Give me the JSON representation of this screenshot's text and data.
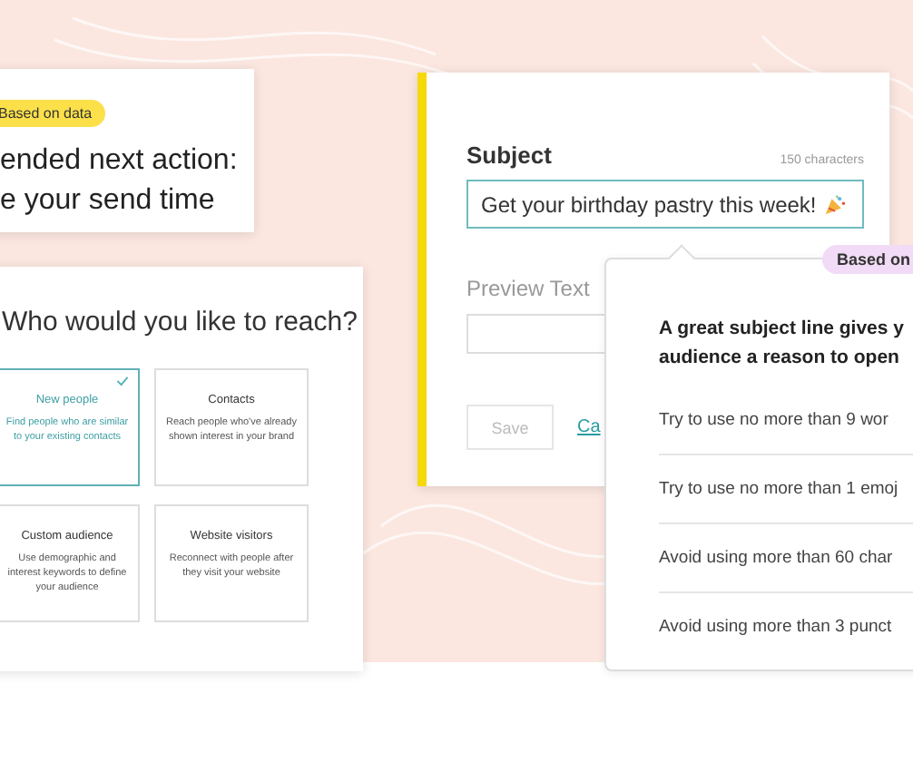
{
  "recommendation_card": {
    "badge": "Based on data",
    "lines": [
      "ended next action:",
      "e your send time"
    ]
  },
  "audience_card": {
    "title": "Who would you like to reach?",
    "options": [
      {
        "title": "New people",
        "description": "Find people who are similar to your existing contacts",
        "selected": true
      },
      {
        "title": "Contacts",
        "description": "Reach people who've already shown interest in your brand",
        "selected": false
      },
      {
        "title": "Custom audience",
        "description": "Use demographic and interest keywords to define your audience",
        "selected": false
      },
      {
        "title": "Website visitors",
        "description": "Reconnect with people after they visit your website",
        "selected": false
      }
    ]
  },
  "email_form": {
    "subject": {
      "label": "Subject",
      "counter": "150 characters",
      "value": "Get your birthday pastry this week!"
    },
    "preview": {
      "label": "Preview Text"
    },
    "actions": [
      {
        "kind": "button",
        "label": "Save",
        "disabled": true
      },
      {
        "kind": "link",
        "label": "Ca"
      }
    ]
  },
  "tips_popover": {
    "badge": "Based on",
    "heading_lines": [
      "A great subject line gives y",
      "audience a reason to open"
    ],
    "tips": [
      "Try to use no more than 9 wor",
      "Try to use no more than 1 emoj",
      "Avoid using more than 60 char",
      "Avoid using more than 3 punct"
    ]
  }
}
